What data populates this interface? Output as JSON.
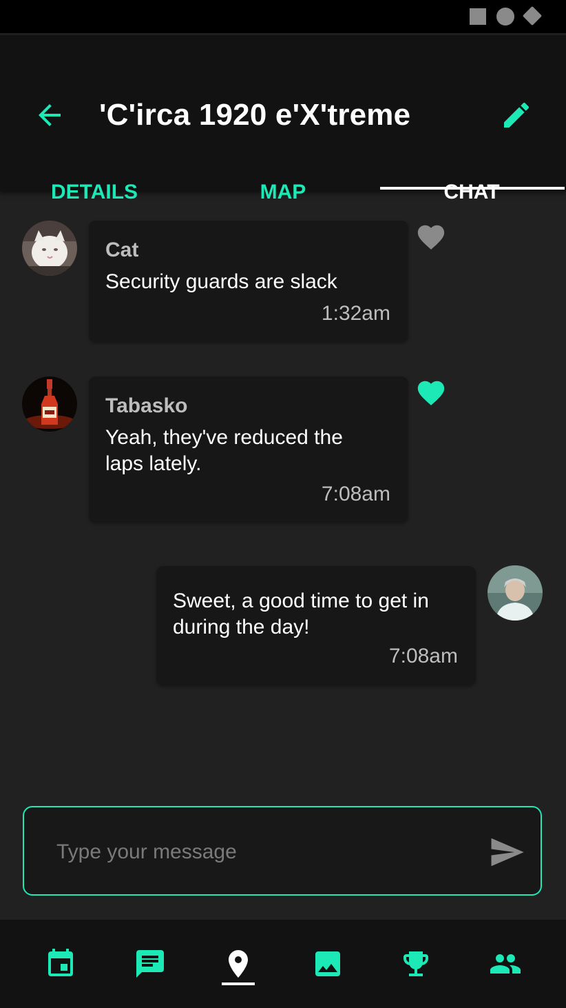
{
  "colors": {
    "accent": "#1de9b6",
    "background": "#212121",
    "bar": "#121212",
    "bubble": "#171717",
    "like_inactive": "#8a8a8a"
  },
  "header": {
    "title": "'C'irca 1920 e'X'treme"
  },
  "tabs": [
    {
      "label": "DETAILS",
      "active": false
    },
    {
      "label": "MAP",
      "active": false
    },
    {
      "label": "CHAT",
      "active": true
    }
  ],
  "messages": [
    {
      "sender": "Cat",
      "lines": [
        "Security guards are slack"
      ],
      "time": "1:32am",
      "liked": false,
      "avatar": "cat-avatar",
      "own": false
    },
    {
      "sender": "Tabasko",
      "lines": [
        "Yeah, they've reduced the",
        "laps lately."
      ],
      "time": "7:08am",
      "liked": true,
      "avatar": "hot-sauce-avatar",
      "own": false
    },
    {
      "sender": "",
      "lines": [
        "Sweet, a good time to get in",
        "during the day!"
      ],
      "time": "7:08am",
      "liked": false,
      "avatar": "user-avatar",
      "own": true
    }
  ],
  "composer": {
    "placeholder": "Type your message",
    "value": ""
  },
  "bottom_nav": [
    {
      "icon": "calendar-icon",
      "active": false
    },
    {
      "icon": "chat-icon",
      "active": false
    },
    {
      "icon": "location-pin-icon",
      "active": true
    },
    {
      "icon": "image-icon",
      "active": false
    },
    {
      "icon": "trophy-icon",
      "active": false
    },
    {
      "icon": "people-icon",
      "active": false
    }
  ]
}
